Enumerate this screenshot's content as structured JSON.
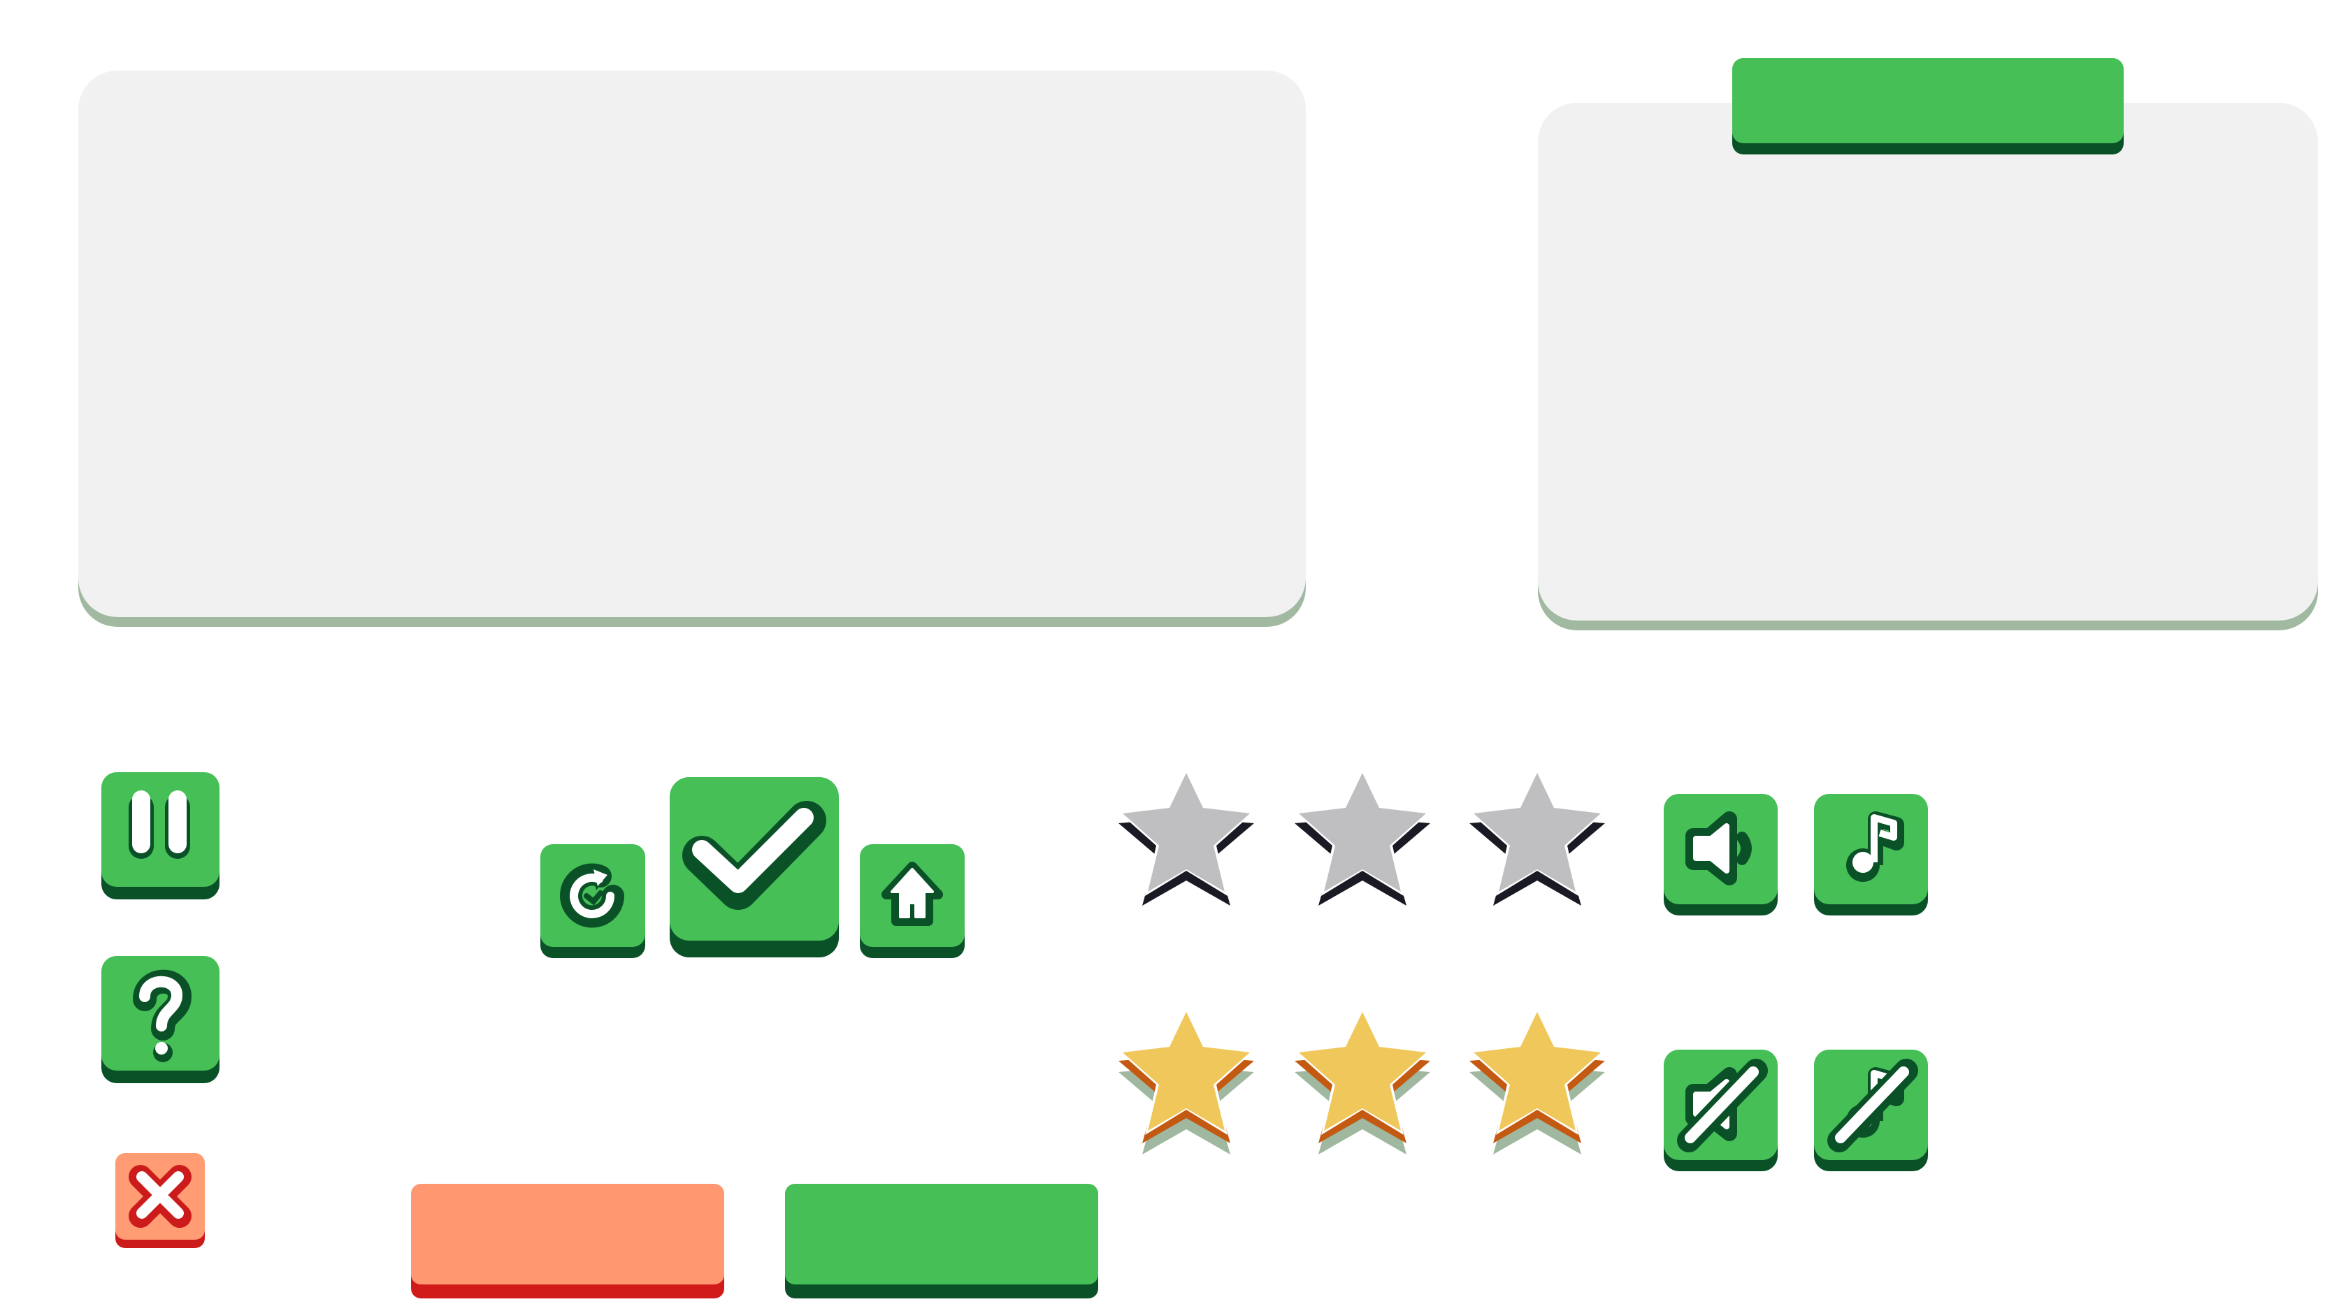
{
  "colors": {
    "panel": "#f0f1f0",
    "panel_shadow": "#a2b9a1",
    "green": "#46bf57",
    "green_dark": "#0a5128",
    "orange": "#ff9870",
    "red_dark": "#d11a1a",
    "star_empty": "#bfbfc1",
    "star_empty_shadow": "#1a1a24",
    "star_gold": "#efc75a",
    "star_gold_shadow": "#c45a12",
    "star_gold_base": "#9fb89f"
  },
  "icons": {
    "pause": "pause-icon",
    "help": "question-icon",
    "close": "close-icon",
    "restart": "restart-icon",
    "confirm": "checkmark-icon",
    "home": "home-icon",
    "sound": "speaker-icon",
    "music": "music-note-icon",
    "sound_off": "speaker-muted-icon",
    "music_off": "music-muted-icon"
  },
  "rating": {
    "max": 3,
    "empty_row": 0,
    "filled_row": 3
  },
  "buttons": {
    "cancel_label": "",
    "ok_label": "",
    "tab_label": ""
  }
}
